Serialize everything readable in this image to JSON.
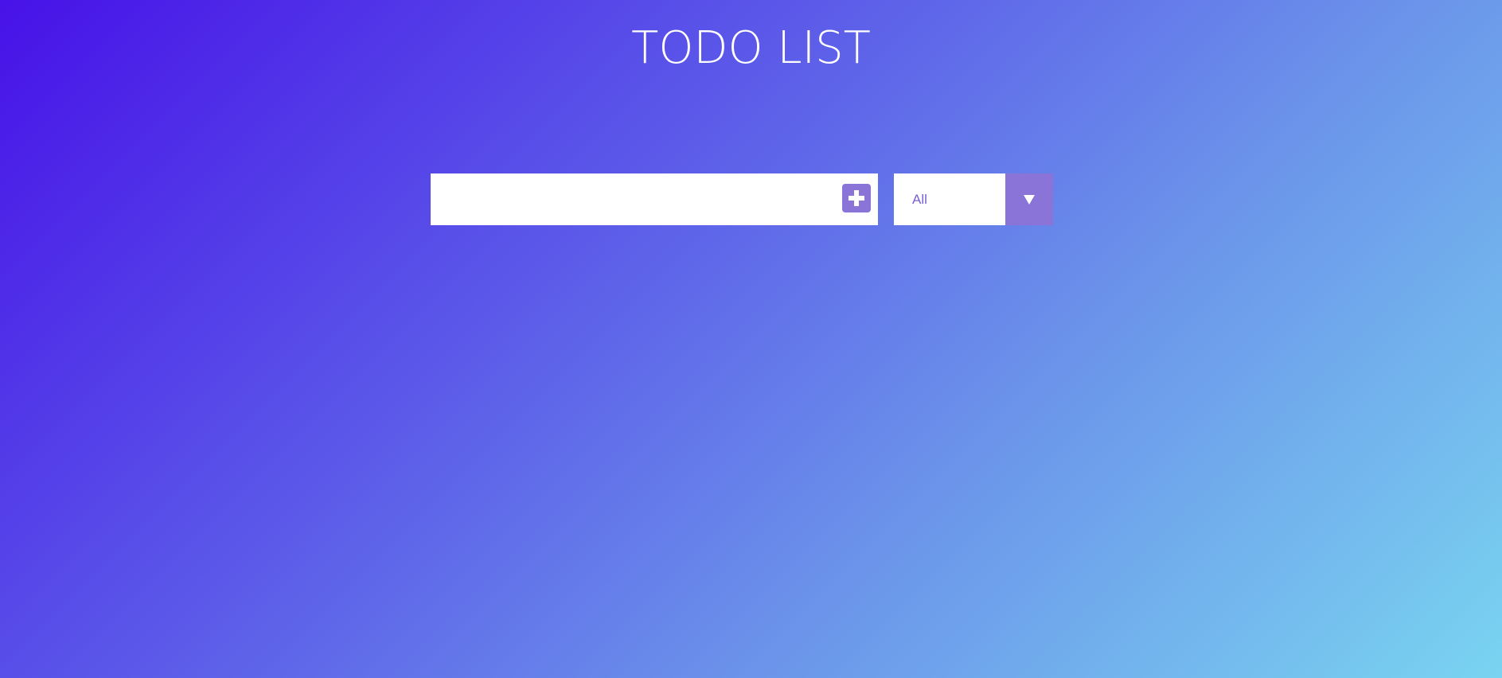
{
  "header": {
    "title": "TODO LIST"
  },
  "todo_form": {
    "input_value": "",
    "input_placeholder": "",
    "add_button_icon": "plus-square-icon"
  },
  "filter": {
    "selected": "All",
    "arrow_icon": "caret-down-icon"
  },
  "colors": {
    "accent": "#8a74d8",
    "filter_text": "#7a5fd4",
    "gradient_start": "#4712e8",
    "gradient_end": "#79d4f0"
  }
}
